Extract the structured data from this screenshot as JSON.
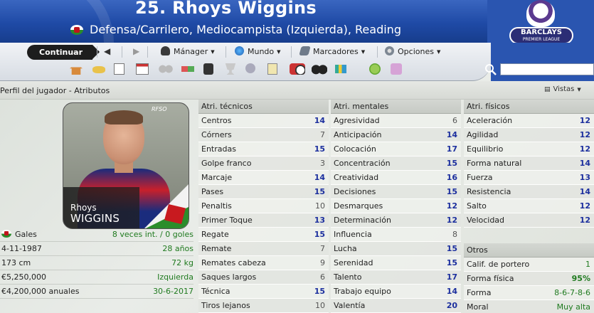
{
  "header": {
    "title": "25. Rhoys Wiggins",
    "subtitle": "Defensa/Carrilero, Mediocampista (Izquierda), Reading",
    "league_logo": {
      "name": "BARCLAYS",
      "sub": "PREMIER LEAGUE"
    }
  },
  "toolbar": {
    "continue_label": "Continuar",
    "menus": [
      "Mánager",
      "Mundo",
      "Marcadores",
      "Opciones"
    ],
    "search_placeholder": ""
  },
  "section": {
    "title": "Perfil del jugador - Atributos",
    "views_label": "Vistas"
  },
  "photo": {
    "first_name": "Rhoys",
    "last_name": "WIGGINS",
    "watermark": "RFSO"
  },
  "info": [
    {
      "label": "Gales",
      "value": "8 veces int. / 0 goles",
      "flag": true
    },
    {
      "label": "4-11-1987",
      "value": "28 años"
    },
    {
      "label": "173 cm",
      "value": "72 kg"
    },
    {
      "label": "€5,250,000",
      "value": "Izquierda"
    },
    {
      "label": "€4,200,000 anuales",
      "value": "30-6-2017"
    }
  ],
  "technical": {
    "header": "Atri. técnicos",
    "rows": [
      {
        "name": "Centros",
        "value": "14"
      },
      {
        "name": "Córners",
        "value": "7"
      },
      {
        "name": "Entradas",
        "value": "15"
      },
      {
        "name": "Golpe franco",
        "value": "3"
      },
      {
        "name": "Marcaje",
        "value": "14"
      },
      {
        "name": "Pases",
        "value": "15"
      },
      {
        "name": "Penaltis",
        "value": "10"
      },
      {
        "name": "Primer Toque",
        "value": "13"
      },
      {
        "name": "Regate",
        "value": "15"
      },
      {
        "name": "Remate",
        "value": "7"
      },
      {
        "name": "Remates cabeza",
        "value": "9"
      },
      {
        "name": "Saques largos",
        "value": "6"
      },
      {
        "name": "Técnica",
        "value": "15"
      },
      {
        "name": "Tiros lejanos",
        "value": "10"
      }
    ]
  },
  "mental": {
    "header": "Atri. mentales",
    "rows": [
      {
        "name": "Agresividad",
        "value": "6"
      },
      {
        "name": "Anticipación",
        "value": "14"
      },
      {
        "name": "Colocación",
        "value": "17"
      },
      {
        "name": "Concentración",
        "value": "15"
      },
      {
        "name": "Creatividad",
        "value": "16"
      },
      {
        "name": "Decisiones",
        "value": "15"
      },
      {
        "name": "Desmarques",
        "value": "12"
      },
      {
        "name": "Determinación",
        "value": "12"
      },
      {
        "name": "Influencia",
        "value": "8"
      },
      {
        "name": "Lucha",
        "value": "15"
      },
      {
        "name": "Serenidad",
        "value": "15"
      },
      {
        "name": "Talento",
        "value": "17"
      },
      {
        "name": "Trabajo equipo",
        "value": "14"
      },
      {
        "name": "Valentía",
        "value": "20"
      }
    ]
  },
  "physical": {
    "header": "Atri. físicos",
    "rows": [
      {
        "name": "Aceleración",
        "value": "12"
      },
      {
        "name": "Agilidad",
        "value": "12"
      },
      {
        "name": "Equilibrio",
        "value": "12"
      },
      {
        "name": "Forma natural",
        "value": "14"
      },
      {
        "name": "Fuerza",
        "value": "13"
      },
      {
        "name": "Resistencia",
        "value": "14"
      },
      {
        "name": "Salto",
        "value": "12"
      },
      {
        "name": "Velocidad",
        "value": "12"
      }
    ]
  },
  "others": {
    "header": "Otros",
    "rows": [
      {
        "name": "Calif. de portero",
        "value": "1"
      },
      {
        "name": "Forma física",
        "value": "95%"
      },
      {
        "name": "Forma",
        "value": "8-6-7-8-6"
      },
      {
        "name": "Moral",
        "value": "Muy alta"
      }
    ]
  },
  "colors": {
    "header_blue": "#1f4aa6",
    "attr_blue": "#1c2f9e",
    "green": "#1f7a1f"
  }
}
